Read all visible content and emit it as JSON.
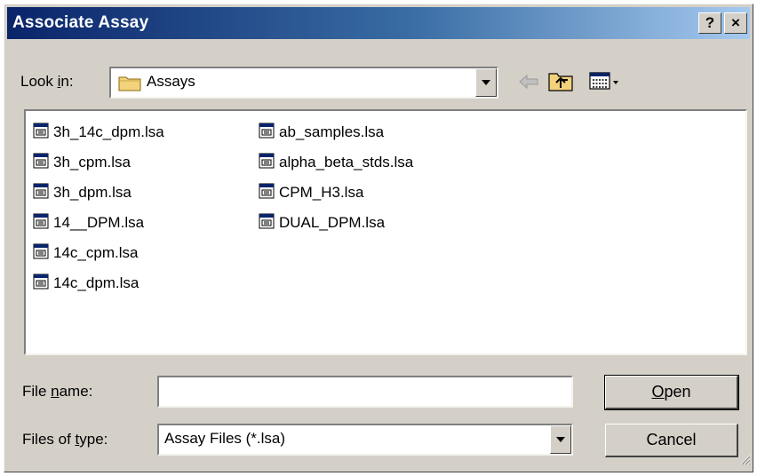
{
  "window": {
    "title": "Associate Assay",
    "help_label": "?",
    "close_label": "×"
  },
  "look_in": {
    "label_pre": "Look ",
    "label_mnemonic": "i",
    "label_post": "n:",
    "value": "Assays"
  },
  "toolbar_icons": [
    "back-arrow-icon",
    "up-folder-icon",
    "view-menu-icon"
  ],
  "files": [
    {
      "name": "3h_14c_dpm.lsa"
    },
    {
      "name": "3h_cpm.lsa"
    },
    {
      "name": "3h_dpm.lsa"
    },
    {
      "name": "14__DPM.lsa"
    },
    {
      "name": "14c_cpm.lsa"
    },
    {
      "name": "14c_dpm.lsa"
    },
    {
      "name": "ab_samples.lsa"
    },
    {
      "name": "alpha_beta_stds.lsa"
    },
    {
      "name": "CPM_H3.lsa"
    },
    {
      "name": "DUAL_DPM.lsa"
    }
  ],
  "file_name": {
    "label_pre": "File ",
    "label_mnemonic": "n",
    "label_post": "ame:",
    "value": ""
  },
  "files_of_type": {
    "label_pre": "Files of ",
    "label_mnemonic": "t",
    "label_post": "ype:",
    "value": "Assay Files (*.lsa)"
  },
  "buttons": {
    "open_mnemonic": "O",
    "open_rest": "pen",
    "cancel": "Cancel"
  },
  "colors": {
    "face": "#d4d0c8",
    "title_start": "#0a246a",
    "title_end": "#a6caf0",
    "folder": "#f2d27a"
  }
}
